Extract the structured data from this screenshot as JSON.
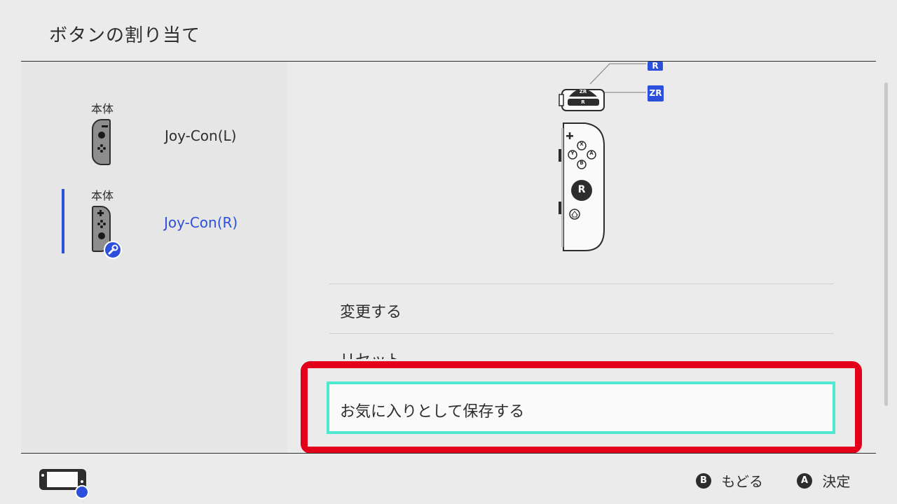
{
  "header": {
    "title": "ボタンの割り当て"
  },
  "controllers": [
    {
      "caption": "本体",
      "name": "Joy-Con(L)",
      "selected": false
    },
    {
      "caption": "本体",
      "name": "Joy-Con(R)",
      "selected": true
    }
  ],
  "diagram": {
    "tags": {
      "r": "R",
      "zr": "ZR"
    },
    "buttons": {
      "zr": "ZR",
      "r": "R",
      "x": "X",
      "y": "Y",
      "a": "A",
      "b": "B",
      "stick": "R",
      "plus": "+"
    }
  },
  "menu": {
    "items": [
      {
        "label": "変更する"
      },
      {
        "label": "リセット"
      },
      {
        "label": "お気に入りとして保存する"
      }
    ],
    "selected_index": 2
  },
  "footer": {
    "back": {
      "glyph": "B",
      "label": "もどる"
    },
    "confirm": {
      "glyph": "A",
      "label": "決定"
    }
  },
  "colors": {
    "accent": "#2c4fdc",
    "selection_border": "#4fe8d0",
    "highlight_frame": "#e2001a"
  }
}
